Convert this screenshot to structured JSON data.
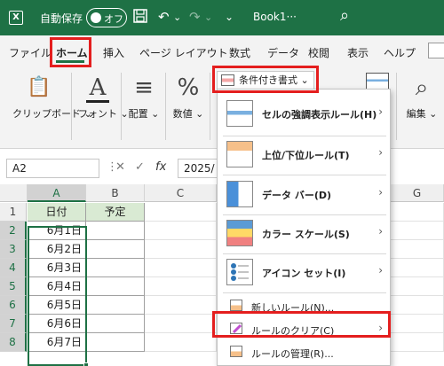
{
  "titlebar": {
    "app_logo": "X",
    "autosave_label": "自動保存",
    "autosave_state": "オフ",
    "save_icon": "save-icon",
    "undo_icon": "↶",
    "redo_icon": "↷",
    "more_icon": "⌄",
    "doc_name": "Book1···",
    "search_icon": "⌕"
  },
  "tabs": [
    "ファイル",
    "ホーム",
    "挿入",
    "ページ レイアウト",
    "数式",
    "データ",
    "校閲",
    "表示",
    "ヘルプ"
  ],
  "ribbon": {
    "clipboard": {
      "icon": "📋",
      "label": "クリップボード ⌄"
    },
    "font": {
      "icon": "A",
      "label": "フォント ⌄"
    },
    "align": {
      "icon": "≡",
      "label": "配置 ⌄"
    },
    "number": {
      "icon": "%",
      "label": "数値 ⌄"
    },
    "edit": {
      "icon": "⌕",
      "label": "編集 ⌄"
    },
    "conditional_format_label": "条件付き書式 ⌄"
  },
  "formula_bar": {
    "name_box": "A2",
    "separator": "⋮",
    "cancel": "✕",
    "enter": "✓",
    "fx": "fx",
    "value": "2025/"
  },
  "grid": {
    "columns": [
      "A",
      "B",
      "C",
      "G"
    ],
    "rows": [
      "1",
      "2",
      "3",
      "4",
      "5",
      "6",
      "7",
      "8"
    ],
    "header_row": [
      "日付",
      "予定"
    ],
    "dates": [
      "6月1日",
      "6月2日",
      "6月3日",
      "6月4日",
      "6月5日",
      "6月6日",
      "6月7日"
    ]
  },
  "menu": {
    "items": [
      {
        "label": "セルの強調表示ルール(H)",
        "icon": "highlight-cells-rules-icon",
        "arrow": "›"
      },
      {
        "label": "上位/下位ルール(T)",
        "icon": "top-bottom-rules-icon",
        "arrow": "›"
      },
      {
        "label": "データ バー(D)",
        "icon": "data-bars-icon",
        "arrow": "›"
      },
      {
        "label": "カラー スケール(S)",
        "icon": "color-scales-icon",
        "arrow": "›"
      },
      {
        "label": "アイコン セット(I)",
        "icon": "icon-sets-icon",
        "arrow": "›"
      }
    ],
    "small_items": [
      {
        "label": "新しいルール(N)...",
        "icon": "new-rule-icon"
      },
      {
        "label": "ルールのクリア(C)",
        "icon": "clear-rules-icon",
        "arrow": "›"
      },
      {
        "label": "ルールの管理(R)...",
        "icon": "manage-rules-icon"
      }
    ]
  },
  "colors": {
    "excel_green": "#1e7145",
    "highlight_red": "#e41e1e",
    "header_fill": "#d9ead3"
  }
}
